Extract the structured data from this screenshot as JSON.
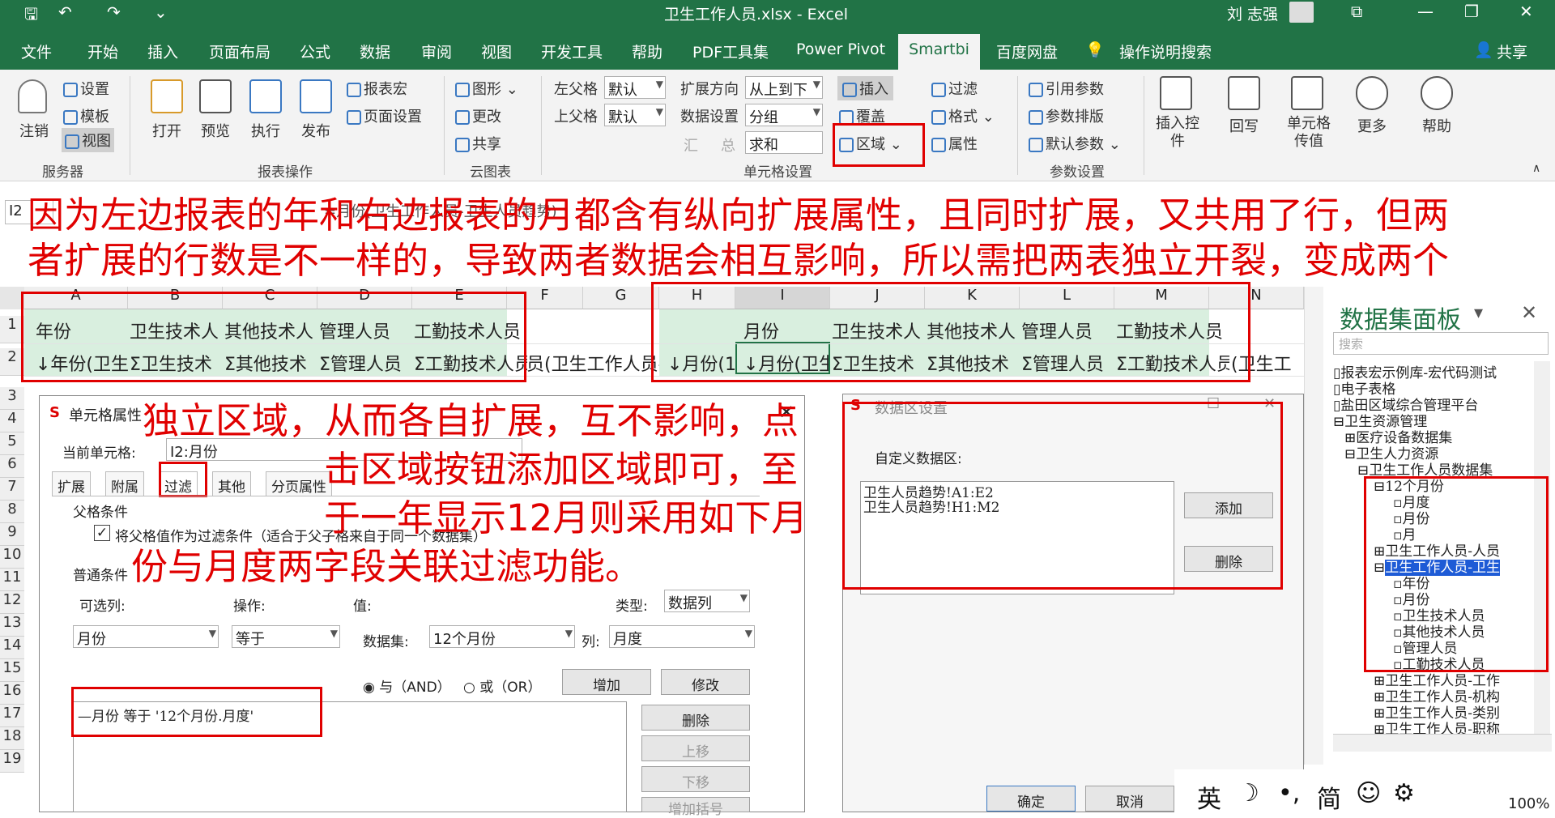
{
  "window": {
    "title": "卫生工作人员.xlsx  -  Excel",
    "user": "刘 志强"
  },
  "menu": [
    "文件",
    "开始",
    "插入",
    "页面布局",
    "公式",
    "数据",
    "审阅",
    "视图",
    "开发工具",
    "帮助",
    "PDF工具集",
    "Power Pivot",
    "Smartbi",
    "百度网盘",
    "操作说明搜索",
    "共享"
  ],
  "ribbon": {
    "server": {
      "logout": "注销",
      "settings": "设置",
      "template": "模板",
      "view": "视图",
      "label": "服务器"
    },
    "report": {
      "open": "打开",
      "preview": "预览",
      "execute": "执行",
      "publish": "发布",
      "macro": "报表宏",
      "page_setup": "页面设置",
      "label": "报表操作"
    },
    "cloud": {
      "graph": "图形",
      "change": "更改",
      "share": "共享",
      "label": "云图表"
    },
    "cell": {
      "left_parent": "左父格",
      "top_parent": "上父格",
      "left_val": "默认",
      "top_val": "默认",
      "expand_dir": "扩展方向",
      "expand_val": "从上到下",
      "data_setting": "数据设置",
      "data_val": "分组",
      "agg1": "汇",
      "agg2": "总",
      "agg_val": "求和",
      "insert": "插入",
      "cover": "覆盖",
      "region": "区域",
      "filter": "过滤",
      "format": "格式",
      "attr": "属性",
      "label": "单元格设置"
    },
    "param": {
      "ref": "引用参数",
      "layout": "参数排版",
      "default": "默认参数",
      "label": "参数设置"
    },
    "extra": {
      "insert_ctrl": "插入控件",
      "writeback": "回写",
      "cell_pass": "单元格传值",
      "more": "更多",
      "help": "帮助"
    }
  },
  "namebox": "I2",
  "formula": "=月份(卫生工作人员-卫生人员趋势)",
  "columns": [
    "A",
    "B",
    "C",
    "D",
    "E",
    "F",
    "G",
    "H",
    "I",
    "J",
    "K",
    "L",
    "M",
    "N"
  ],
  "rows": [
    "1",
    "2",
    "3",
    "4",
    "5",
    "6",
    "7",
    "8",
    "9",
    "10",
    "11",
    "12",
    "13",
    "14",
    "15",
    "16",
    "17",
    "18",
    "19"
  ],
  "row1": {
    "a": "年份",
    "b": "卫生技术人",
    "c": "其他技术人",
    "d": "管理人员",
    "e": "工勤技术人员",
    "i": "月份",
    "j": "卫生技术人",
    "k": "其他技术人",
    "l": "管理人员",
    "m": "工勤技术人员"
  },
  "row2": {
    "a": "↓年份(卫生",
    "b": "Σ卫生技术",
    "c": "Σ其他技术",
    "d": "Σ管理人员",
    "e": "Σ工勤技术人员",
    "f": "员(卫生工作人员-",
    "h": "↓月份(1",
    "i": "↓月份(卫生",
    "j": "Σ卫生技术",
    "k": "Σ其他技术",
    "l": "Σ管理人员",
    "m": "Σ工勤技术人员",
    "n": "(卫生工"
  },
  "annotations": {
    "a1": "因为左边报表的年和右边报表的月都含有纵向扩展属性，且同时扩展，又共用了行，但两",
    "a2": "者扩展的行数是不一样的，导致两者数据会相互影响，所以需把两表独立开裂，变成两个",
    "b1": "独立区域，从而各自扩展，互不影响，点",
    "b2": "击区域按钮添加区域即可，至",
    "b3": "于一年显示12月则采用如下月",
    "b4": "份与月度两字段关联过滤功能。"
  },
  "cell_dialog": {
    "title": "单元格属性",
    "current_label": "当前单元格:",
    "current_val": "I2:月份",
    "tabs": [
      "扩展",
      "附属",
      "过滤",
      "其他",
      "分页属性"
    ],
    "parent_section": "父格条件",
    "parent_check": "将父格值作为过滤条件（适合于父子格来自于同一个数据集）",
    "normal_section": "普通条件",
    "optional_col": "可选列:",
    "operation": "操作:",
    "value": "值:",
    "type": "类型:",
    "type_val": "数据列",
    "col_val": "月份",
    "op_val": "等于",
    "dataset_label": "数据集:",
    "dataset_val": "12个月份",
    "col_label": "列:",
    "col2_val": "月度",
    "and": "与（AND）",
    "or": "或（OR）",
    "add": "增加",
    "modify": "修改",
    "condition": "—月份 等于 '12个月份.月度'",
    "delete": "删除",
    "up": "上移",
    "down": "下移",
    "add_bracket": "增加括号"
  },
  "region_dialog": {
    "title": "数据区设置",
    "label": "自定义数据区:",
    "items": [
      "卫生人员趋势!A1:E2",
      "卫生人员趋势!H1:M2"
    ],
    "add": "添加",
    "delete": "删除",
    "ok": "确定",
    "cancel": "取消"
  },
  "panel": {
    "title": "数据集面板",
    "search": "搜索",
    "tree": [
      "报表宏示例库-宏代码测试",
      "电子表格",
      "盐田区域综合管理平台",
      "卫生资源管理",
      "医疗设备数据集",
      "卫生人力资源",
      "卫生工作人员数据集",
      "12个月份",
      "月度",
      "月份",
      "月",
      "卫生工作人员-人员",
      "卫生工作人员-卫生",
      "年份",
      "月份",
      "卫生技术人员",
      "其他技术人员",
      "管理人员",
      "工勤技术人员",
      "卫生工作人员-工作",
      "卫生工作人员-机构",
      "卫生工作人员-类别",
      "卫生工作人员-职称"
    ]
  },
  "tray": {
    "ime": "英",
    "moon": "☽",
    "punct": "•,",
    "simp": "简",
    "emoji": "☺",
    "gear": "⚙",
    "zoom": "100%"
  }
}
